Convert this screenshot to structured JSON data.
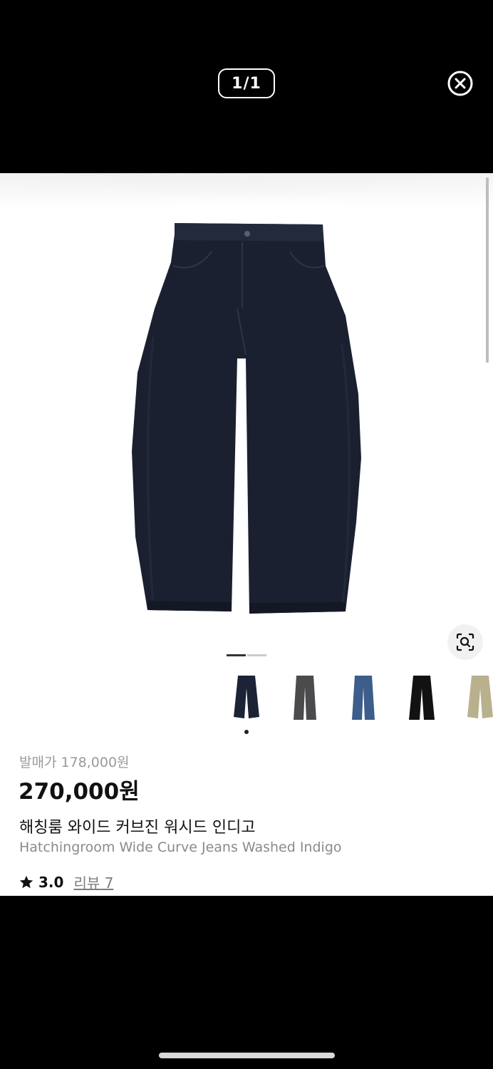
{
  "viewer": {
    "page_counter": "1/1"
  },
  "gallery": {
    "active_index": 0,
    "total_indicators": 2,
    "thumbnails": [
      {
        "name": "indigo",
        "color": "#1d2336"
      },
      {
        "name": "charcoal",
        "color": "#4b4b4e"
      },
      {
        "name": "mid-blue",
        "color": "#3d5d8a"
      },
      {
        "name": "black",
        "color": "#121212"
      },
      {
        "name": "khaki",
        "color": "#b9b08e"
      }
    ]
  },
  "product": {
    "original_price": "발매가 178,000원",
    "price": "270,000원",
    "name_ko": "해칭룸 와이드 커브진 워시드 인디고",
    "name_en": "Hatchingroom Wide Curve Jeans Washed Indigo",
    "rating": "3.0",
    "review_label": "리뷰 7"
  },
  "icons": {
    "close": "close-circle-icon",
    "visual_search": "visual-search-icon",
    "star": "star-icon"
  }
}
